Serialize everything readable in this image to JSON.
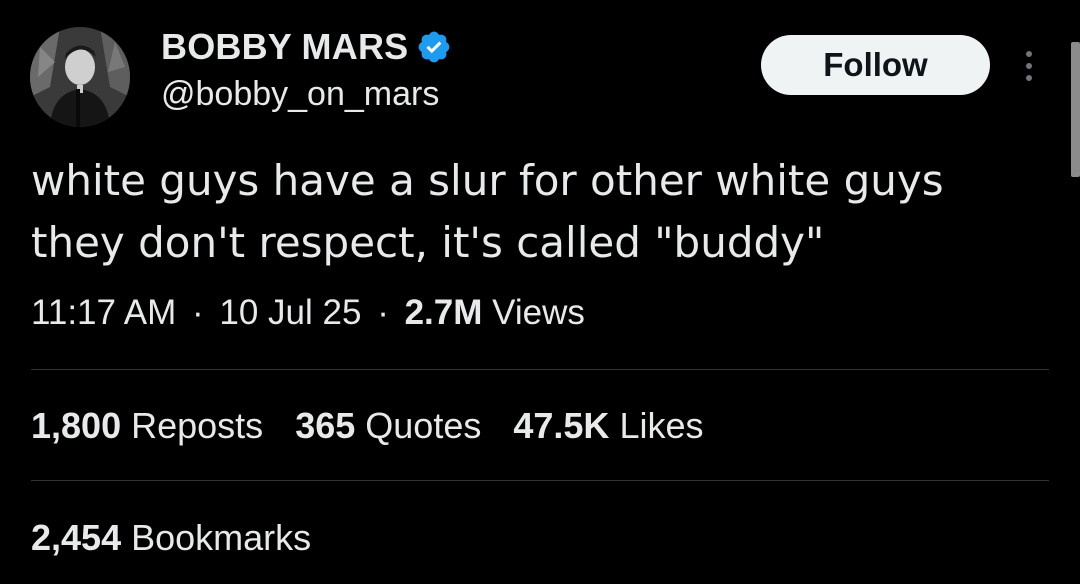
{
  "author": {
    "display_name": "BOBBY MARS",
    "handle": "@bobby_on_mars",
    "verified": true,
    "verified_color": "#1d9bf0"
  },
  "follow_button": {
    "label": "Follow"
  },
  "more_menu": {
    "icon": "more-vertical-icon"
  },
  "tweet": {
    "lines": [
      "white guys have a slur for other white guys",
      "they don't respect, it's called \"buddy\""
    ]
  },
  "meta": {
    "time": "11:17 AM",
    "separator": "·",
    "date": "10 Jul 25",
    "views_count": "2.7M",
    "views_label": "Views"
  },
  "stats": {
    "reposts": {
      "count": "1,800",
      "label": "Reposts"
    },
    "quotes": {
      "count": "365",
      "label": "Quotes"
    },
    "likes": {
      "count": "47.5K",
      "label": "Likes"
    },
    "bookmarks": {
      "count": "2,454",
      "label": "Bookmarks"
    }
  },
  "colors": {
    "background": "#000000",
    "text": "#e7e9ea",
    "divider": "#2f3336",
    "follow_bg": "#eff3f4",
    "follow_text": "#0f1419"
  }
}
